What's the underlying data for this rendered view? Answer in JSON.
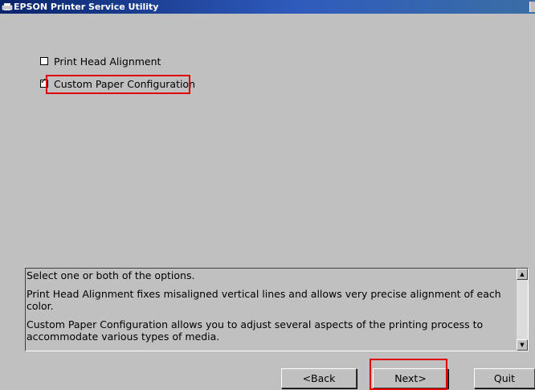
{
  "window": {
    "title": "EPSON Printer Service Utility"
  },
  "options": [
    {
      "label": "Print Head Alignment",
      "checked": false
    },
    {
      "label": "Custom Paper Configuration",
      "checked": true
    }
  ],
  "description": {
    "lines": [
      "Select one or both of the options.",
      "Print Head Alignment fixes misaligned vertical lines and allows very precise alignment of each color.",
      "Custom Paper Configuration allows you to adjust several aspects of the printing process to accommodate various types of media."
    ]
  },
  "buttons": {
    "back": "<Back",
    "next": "Next>",
    "quit": "Quit"
  },
  "icons": {
    "app": "printer-icon",
    "check": "check-icon",
    "scroll_up": "scroll-up-icon",
    "scroll_down": "scroll-down-icon"
  },
  "colors": {
    "titlebar": "#0a246a",
    "highlight": "#e00000",
    "background": "#c0c0c0"
  }
}
